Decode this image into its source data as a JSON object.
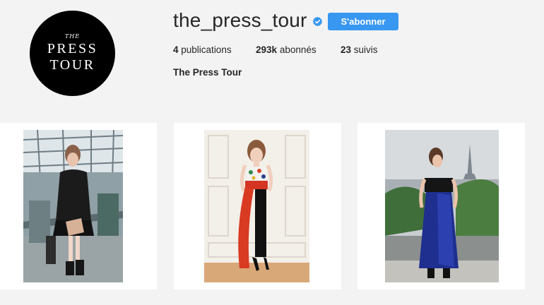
{
  "profile": {
    "avatar": {
      "logo_small": "THE",
      "logo_line1": "PRESS",
      "logo_line2": "TOUR"
    },
    "username": "the_press_tour",
    "verified": true,
    "follow_label": "S'abonner",
    "stats": {
      "posts_value": "4",
      "posts_label": "publications",
      "followers_value": "293k",
      "followers_label": "abonnés",
      "following_value": "23",
      "following_label": "suivis"
    },
    "full_name": "The Press Tour"
  },
  "posts": [
    {
      "media": "video",
      "icon": "video-camera-icon"
    },
    {
      "media": "video",
      "icon": "video-camera-icon"
    },
    {
      "media": "video",
      "icon": "video-camera-icon"
    }
  ],
  "colors": {
    "accent": "#3897f0",
    "text": "#262626",
    "background": "#f3f3f3"
  }
}
